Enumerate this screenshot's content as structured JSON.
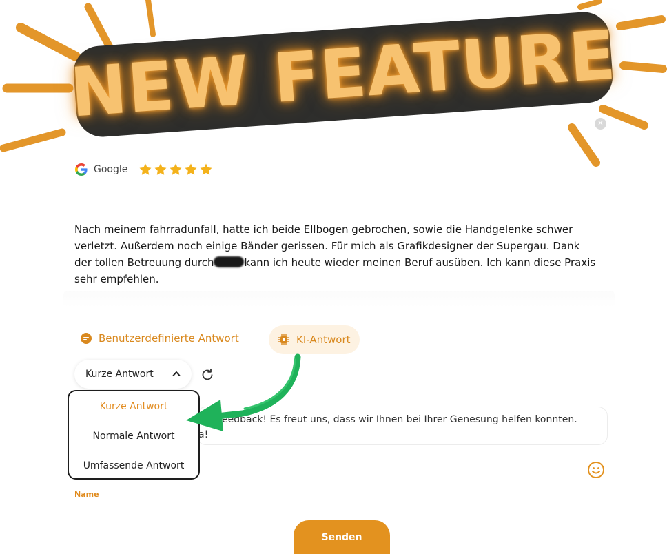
{
  "banner": {
    "title": "NEW FEATURE"
  },
  "review": {
    "source": "Google",
    "rating": 5,
    "text_part1": "Nach meinem fahrradunfall, hatte ich beide Ellbogen gebrochen, sowie die Handgelenke schwer verletzt. Außerdem noch einige Bänder gerissen. Für mich als Grafikdesigner der Supergau. Dank der tollen Betreuung durch",
    "text_part2": "kann ich heute wieder meinen Beruf ausüben. Ich kann diese Praxis sehr empfehlen."
  },
  "tabs": {
    "custom": "Benutzerdefinierte Antwort",
    "ai": "KI-Antwort"
  },
  "length_select": {
    "selected": "Kurze Antwort",
    "options": [
      "Kurze Antwort",
      "Normale Antwort",
      "Umfassende Antwort"
    ]
  },
  "reply": {
    "line1": "eedback! Es freut uns, dass wir Ihnen bei Ihrer Genesung helfen konnten.",
    "line2": "a!"
  },
  "form": {
    "name_label": "Name",
    "send_label": "Senden"
  },
  "colors": {
    "accent": "#e3921f",
    "banner_bg": "#2e2e2c",
    "banner_text": "#f7c270",
    "arrow": "#1fb25a",
    "star": "#f4b21b"
  },
  "icons": {
    "close": "close-icon",
    "google": "google-icon",
    "star": "star-icon",
    "custom_tab": "chat-bubble-icon",
    "ai_tab": "ai-chip-icon",
    "chevron": "chevron-up-icon",
    "refresh": "refresh-icon",
    "emoji": "smiley-icon"
  }
}
